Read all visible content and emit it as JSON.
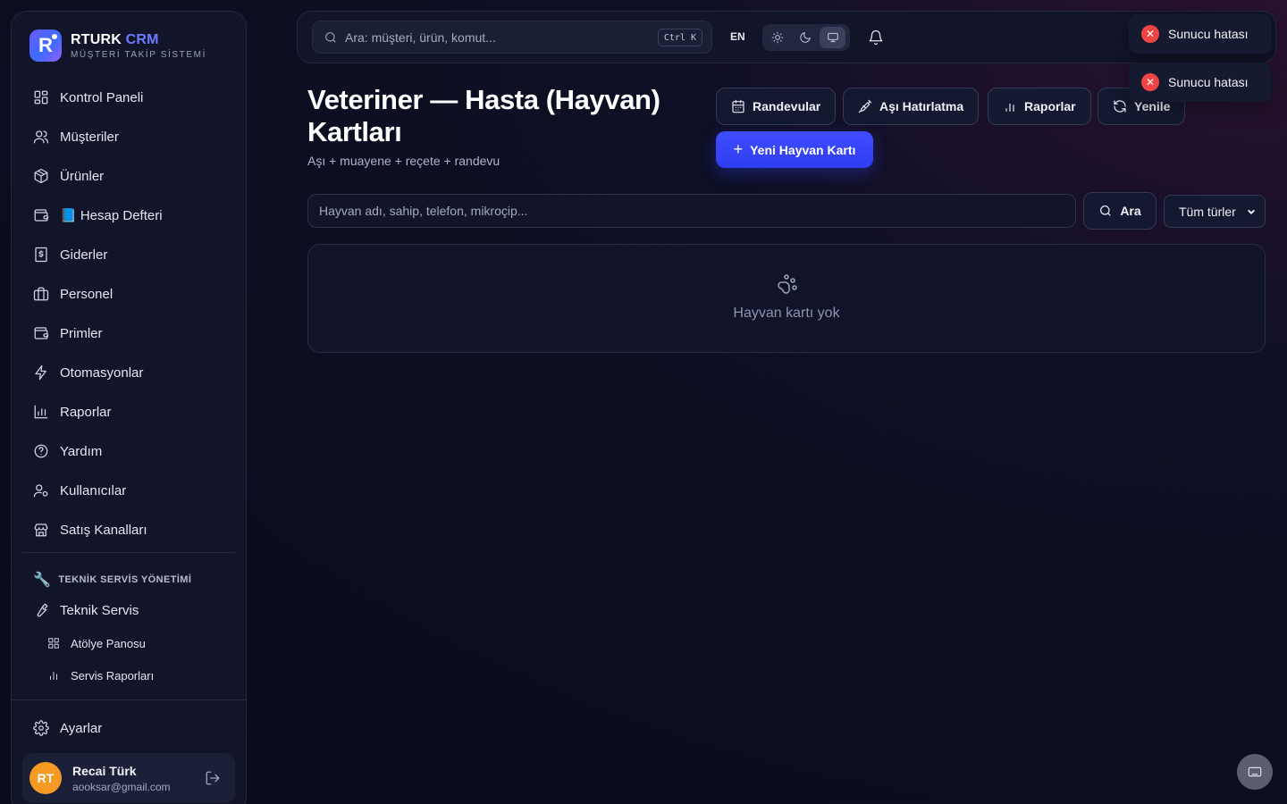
{
  "brand": {
    "name": "RTURK",
    "accent": "CRM",
    "subtitle": "MÜŞTERİ TAKİP SİSTEMİ",
    "logo_letter": "R"
  },
  "sidebar": {
    "items": [
      {
        "label": "Kontrol Paneli",
        "icon": "dashboard-icon"
      },
      {
        "label": "Müşteriler",
        "icon": "users-icon"
      },
      {
        "label": "Ürünler",
        "icon": "package-icon"
      },
      {
        "label": "📘 Hesap Defteri",
        "icon": "wallet-icon"
      },
      {
        "label": "Giderler",
        "icon": "receipt-icon"
      },
      {
        "label": "Personel",
        "icon": "briefcase-icon"
      },
      {
        "label": "Primler",
        "icon": "wallet-icon"
      },
      {
        "label": "Otomasyonlar",
        "icon": "bolt-icon"
      },
      {
        "label": "Raporlar",
        "icon": "bar-chart-icon"
      },
      {
        "label": "Yardım",
        "icon": "help-icon"
      },
      {
        "label": "Kullanıcılar",
        "icon": "user-gear-icon"
      },
      {
        "label": "Satış Kanalları",
        "icon": "store-icon"
      }
    ],
    "section_title": "TEKNİK SERVİS YÖNETİMİ",
    "service_item": "Teknik Servis",
    "service_sub": [
      {
        "label": "Atölye Panosu",
        "icon": "grid-icon"
      },
      {
        "label": "Servis Raporları",
        "icon": "bar-chart-icon"
      }
    ],
    "settings": "Ayarlar"
  },
  "user": {
    "initials": "RT",
    "name": "Recai Türk",
    "email": "aooksar@gmail.com"
  },
  "topbar": {
    "search_placeholder": "Ara: müşteri, ürün, komut...",
    "shortcut": "Ctrl K",
    "language": "EN",
    "theme_options": [
      "light",
      "dark",
      "system"
    ],
    "theme_selected": "system"
  },
  "page": {
    "title": "Veteriner — Hasta (Hayvan) Kartları",
    "subtitle": "Aşı + muayene + reçete + randevu"
  },
  "actions": {
    "appointments": "Randevular",
    "vaccine_reminder": "Aşı Hatırlatma",
    "reports": "Raporlar",
    "refresh": "Yenile",
    "new_card": "Yeni Hayvan Kartı"
  },
  "filter": {
    "placeholder": "Hayvan adı, sahip, telefon, mikroçip...",
    "search_label": "Ara",
    "type_selected": "Tüm türler"
  },
  "empty_state": {
    "text": "Hayvan kartı yok"
  },
  "toasts": [
    "Sunucu hatası",
    "Sunucu hatası"
  ],
  "colors": {
    "primary": "#3f4cff",
    "error": "#ef4444",
    "avatar": "#f59a23"
  }
}
